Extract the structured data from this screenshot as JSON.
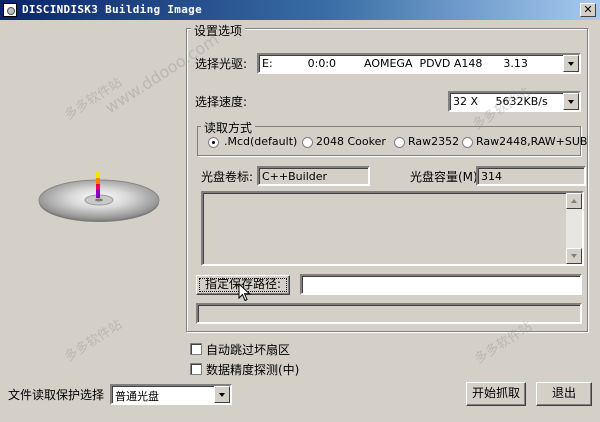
{
  "window": {
    "title": "DISCINDISK3 Building Image"
  },
  "options_group": {
    "title": "设置选项"
  },
  "drive": {
    "label": "选择光驱:",
    "value": "E:          0:0:0        AOMEGA  PDVD A148      3.13"
  },
  "speed": {
    "label": "选择速度:",
    "value": "32 X     5632KB/s"
  },
  "read_mode": {
    "title": "读取方式",
    "options": [
      {
        "label": ".Mcd(default)",
        "selected": true
      },
      {
        "label": "2048 Cooker",
        "selected": false
      },
      {
        "label": "Raw2352",
        "selected": false
      },
      {
        "label": "Raw2448,RAW+SUB",
        "selected": false
      }
    ]
  },
  "disc_label": {
    "label": "光盘卷标:",
    "value": "C++Builder"
  },
  "disc_capacity": {
    "label": "光盘容量(M):",
    "value": "314"
  },
  "save_path": {
    "button_label": "指定保存路径:",
    "value": ""
  },
  "checkboxes": [
    {
      "label": "自动跳过坏扇区",
      "checked": false
    },
    {
      "label": "数据精度探测(中)",
      "checked": false
    }
  ],
  "protection": {
    "label": "文件读取保护选择",
    "value": "普通光盘"
  },
  "buttons": {
    "start": "开始抓取",
    "exit": "退出"
  },
  "watermarks": [
    "多多软件站",
    "www.ddooo.com",
    "多多软件站",
    "多多软件站",
    "多多软件站"
  ]
}
